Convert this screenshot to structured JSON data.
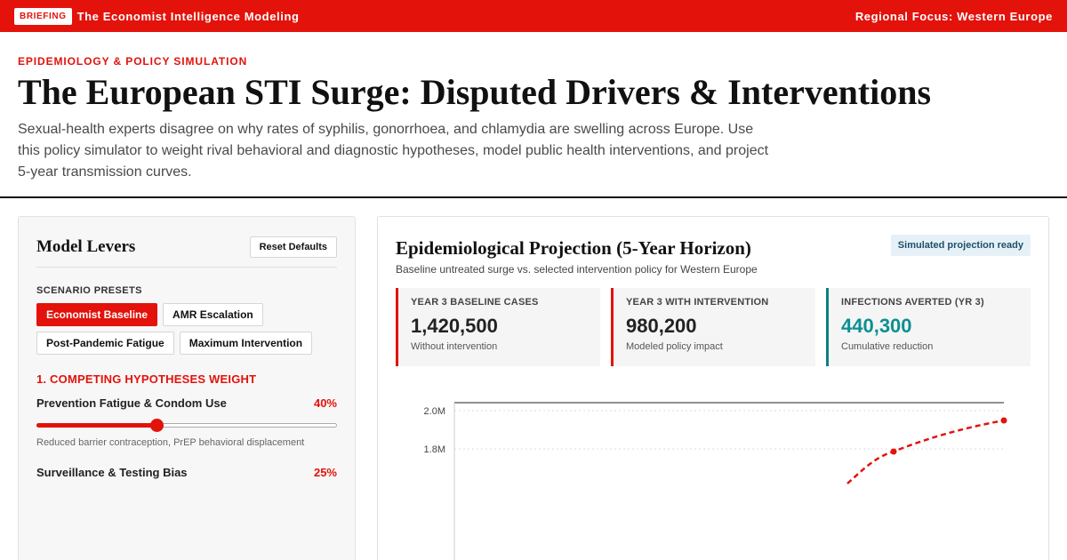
{
  "topbar": {
    "badge": "BRIEFING",
    "title": "The Economist Intelligence Modeling",
    "region": "Regional Focus: Western Europe"
  },
  "header": {
    "kicker": "EPIDEMIOLOGY & POLICY SIMULATION",
    "title": "The European STI Surge: Disputed Drivers & Interventions",
    "description": "Sexual-health experts disagree on why rates of syphilis, gonorrhoea, and chlamydia are swelling across Europe. Use this policy simulator to weight rival behavioral and diagnostic hypotheses, model public health interventions, and project 5-year transmission curves."
  },
  "levers": {
    "title": "Model Levers",
    "reset_label": "Reset Defaults",
    "presets_label": "SCENARIO PRESETS",
    "presets": [
      {
        "label": "Economist Baseline",
        "active": true
      },
      {
        "label": "AMR Escalation",
        "active": false
      },
      {
        "label": "Post-Pandemic Fatigue",
        "active": false
      },
      {
        "label": "Maximum Intervention",
        "active": false
      }
    ],
    "group_title": "1. COMPETING HYPOTHESES WEIGHT",
    "sliders": [
      {
        "label": "Prevention Fatigue & Condom Use",
        "value": 40,
        "value_text": "40%",
        "note": "Reduced barrier contraception, PrEP behavioral displacement"
      },
      {
        "label": "Surveillance & Testing Bias",
        "value": 25,
        "value_text": "25%",
        "note": ""
      }
    ]
  },
  "projection": {
    "title": "Epidemiological Projection (5-Year Horizon)",
    "subtitle": "Baseline untreated surge vs. selected intervention policy for Western Europe",
    "status": "Simulated projection ready",
    "cards": [
      {
        "label": "YEAR 3 BASELINE CASES",
        "value": "1,420,500",
        "note": "Without intervention",
        "accent": "#e3120b"
      },
      {
        "label": "YEAR 3 WITH INTERVENTION",
        "value": "980,200",
        "note": "Modeled policy impact",
        "accent": "#e3120b"
      },
      {
        "label": "INFECTIONS AVERTED (YR 3)",
        "value": "440,300",
        "note": "Cumulative reduction",
        "accent": "#0d7f80"
      }
    ]
  },
  "chart_data": {
    "type": "line",
    "y_ticks": [
      "2.0M",
      "1.8M"
    ],
    "ylim": [
      1.6,
      2.0
    ],
    "series": [
      {
        "color": "#e3120b",
        "style": "dashed",
        "x": [
          4,
          5
        ],
        "y": [
          1.82,
          1.98
        ]
      }
    ]
  }
}
